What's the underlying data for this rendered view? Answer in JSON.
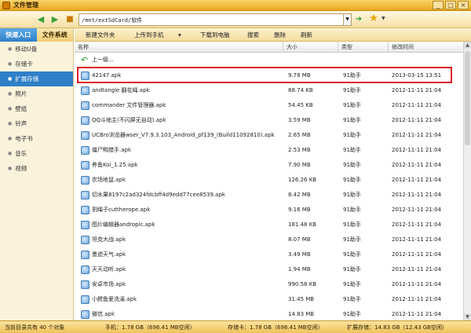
{
  "window": {
    "title": "文件管理",
    "minimize": "_",
    "maximize": "□",
    "close": "×"
  },
  "address": {
    "path": "/mnt/extSdCard/软件"
  },
  "sidebar": {
    "tabs": [
      {
        "label": "快速入口"
      },
      {
        "label": "文件系统"
      }
    ],
    "items": [
      {
        "label": "移动U盘"
      },
      {
        "label": "存储卡"
      },
      {
        "label": "扩展存储"
      },
      {
        "label": "照片"
      },
      {
        "label": "壁纸"
      },
      {
        "label": "铃声"
      },
      {
        "label": "电子书"
      },
      {
        "label": "音乐"
      },
      {
        "label": "视频"
      }
    ]
  },
  "toolbar": {
    "new_folder": "新建文件夹",
    "upload": "上传到手机",
    "upload_arrow": "▾",
    "download": "下载到电脑",
    "search": "搜索",
    "delete": "删除",
    "refresh": "刷新"
  },
  "columns": {
    "name": "名称",
    "size": "大小",
    "type": "类型",
    "modified": "修改时间"
  },
  "up_row": {
    "label": "上一级..."
  },
  "files": [
    {
      "name": "42147.apk",
      "size": "9.78 MB",
      "type": "91助手",
      "date": "2013-03-15 13:51"
    },
    {
      "name": "andtangle  翻花绳.apk",
      "size": "88.74 KB",
      "type": "91助手",
      "date": "2012-11-11 21:04"
    },
    {
      "name": "commander 文件管理器.apk",
      "size": "54.45 KB",
      "type": "91助手",
      "date": "2012-11-11 21:04"
    },
    {
      "name": "QQ斗地主(不闪屏无自动).apk",
      "size": "3.59 MB",
      "type": "91助手",
      "date": "2012-11-11 21:04"
    },
    {
      "name": "UCBro浏览器wser_V7.9.3.103_Android_pf139_(Build11092810).apk",
      "size": "2.65 MB",
      "type": "91助手",
      "date": "2012-11-11 21:04"
    },
    {
      "name": "僵尸鸭猎手.apk",
      "size": "2.53 MB",
      "type": "91助手",
      "date": "2012-11-11 21:04"
    },
    {
      "name": "养鱼Koi_1.25.apk",
      "size": "7.90 MB",
      "type": "91助手",
      "date": "2012-11-11 21:04"
    },
    {
      "name": "农场地鼠.apk",
      "size": "126.26 KB",
      "type": "91助手",
      "date": "2012-11-11 21:04"
    },
    {
      "name": "切水果8197c2ad324fdcbff4d9edd77cee8539.apk",
      "size": "8.42 MB",
      "type": "91助手",
      "date": "2012-11-11 21:04"
    },
    {
      "name": "割绳子cuttherope.apk",
      "size": "9.16 MB",
      "type": "91助手",
      "date": "2012-11-11 21:04"
    },
    {
      "name": "图片编辑器andropic.apk",
      "size": "181.48 KB",
      "type": "91助手",
      "date": "2012-11-11 21:04"
    },
    {
      "name": "坦克大战.apk",
      "size": "8.07 MB",
      "type": "91助手",
      "date": "2012-11-11 21:04"
    },
    {
      "name": "墨迹天气.apk",
      "size": "3.49 MB",
      "type": "91助手",
      "date": "2012-11-11 21:04"
    },
    {
      "name": "天天动听.apk",
      "size": "1.94 MB",
      "type": "91助手",
      "date": "2012-11-11 21:04"
    },
    {
      "name": "安卓市场.apk",
      "size": "990.58 KB",
      "type": "91助手",
      "date": "2012-11-11 21:04"
    },
    {
      "name": "小鳄鱼爱洗澡.apk",
      "size": "31.45 MB",
      "type": "91助手",
      "date": "2012-11-11 21:04"
    },
    {
      "name": "微信.apk",
      "size": "14.83 MB",
      "type": "91助手",
      "date": "2012-11-11 21:04"
    }
  ],
  "status": {
    "current": "当前目录共有 40 个对象",
    "phone": "手机：1.78 GB（696.41 MB空闲）",
    "sdcard": "存储卡：1.78 GB（696.41 MB空闲）",
    "ext": "扩展存储：14.83 GB（12.43 GB空闲）"
  },
  "colors": {
    "accent": "#2f7fc8",
    "highlight": "#e0202a",
    "title_bar": "#e9a820"
  }
}
